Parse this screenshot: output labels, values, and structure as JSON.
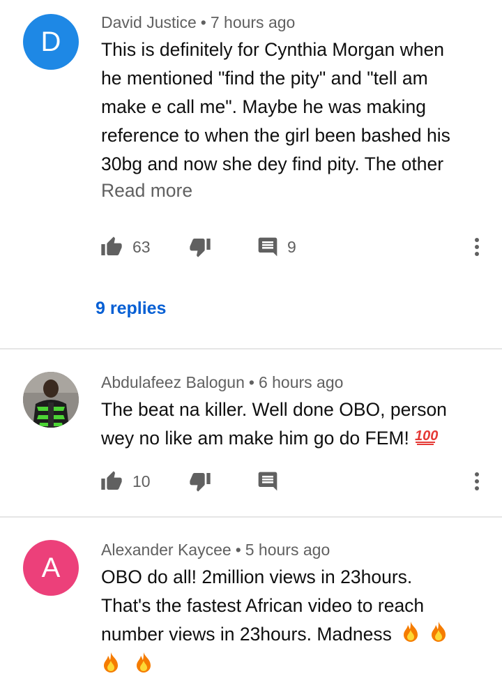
{
  "comments": [
    {
      "author": "David Justice",
      "time": "7 hours ago",
      "avatar_letter": "D",
      "avatar_color": "#1e88e5",
      "lines": [
        "This is definitely for Cynthia Morgan when",
        "he mentioned \"find the pity\" and \"tell am",
        "make e call me\". Maybe he was making",
        "reference to when the girl been bashed his",
        "30bg and now she dey find pity. The other"
      ],
      "read_more": "Read more",
      "likes": "63",
      "reply_count": "9",
      "replies_link": "9 replies"
    },
    {
      "author": "Abdulafeez Balogun",
      "time": "6 hours ago",
      "lines": [
        "The beat na killer. Well done OBO, person",
        "wey no like am make him go do FEM!"
      ],
      "emoji": "💯",
      "likes": "10"
    },
    {
      "author": "Alexander Kaycee",
      "time": "5 hours ago",
      "avatar_letter": "A",
      "avatar_color": "#ec407a",
      "lines": [
        "OBO do all! 2million views in 23hours.",
        "That's the fastest African video to reach",
        "number views in 23hours. Madness"
      ],
      "emoji_fire": "🔥"
    }
  ],
  "separator_dot": "•",
  "icons": {
    "like": "thumb-up-icon",
    "dislike": "thumb-down-icon",
    "reply": "comment-icon",
    "more": "more-vert-icon"
  }
}
